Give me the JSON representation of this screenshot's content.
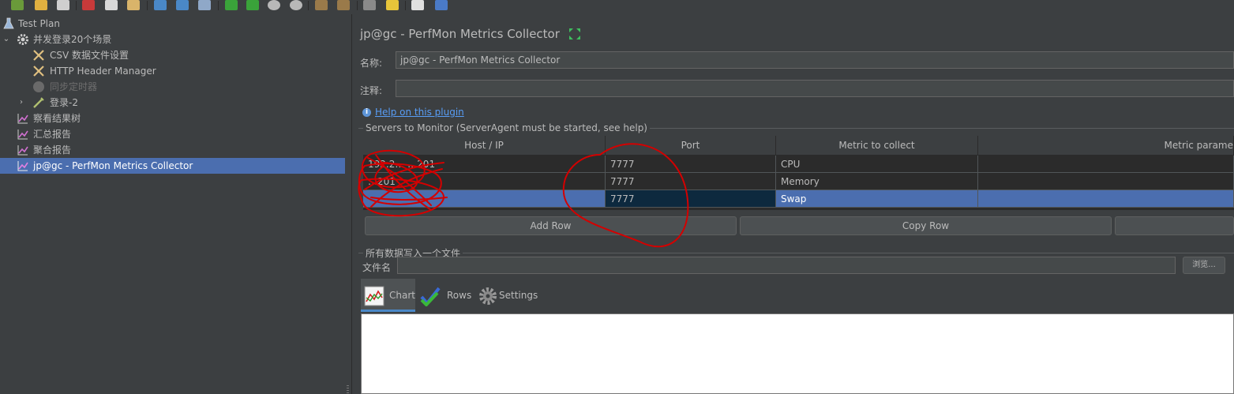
{
  "tree": {
    "items": [
      {
        "label": "Test Plan",
        "icon": "flask-icon"
      },
      {
        "label": "并发登录20个场景",
        "icon": "gear-icon"
      },
      {
        "label": "CSV 数据文件设置",
        "icon": "wrench-icon"
      },
      {
        "label": "HTTP Header Manager",
        "icon": "wrench-icon"
      },
      {
        "label": "同步定时器",
        "icon": "timer-icon",
        "disabled": true
      },
      {
        "label": "登录-2",
        "icon": "pipette-icon"
      },
      {
        "label": "察看结果树",
        "icon": "graph-icon"
      },
      {
        "label": "汇总报告",
        "icon": "graph-icon"
      },
      {
        "label": "聚合报告",
        "icon": "graph-icon"
      },
      {
        "label": "jp@gc - PerfMon Metrics Collector",
        "icon": "graph-icon",
        "selected": true
      }
    ]
  },
  "panel": {
    "title": "jp@gc - PerfMon Metrics Collector",
    "name_label": "名称:",
    "name_value": "jp@gc - PerfMon Metrics Collector",
    "comment_label": "注释:",
    "comment_value": "",
    "help_link": "Help on this plugin",
    "servers_group_title": "Servers to Monitor (ServerAgent must be started, see help)",
    "table": {
      "columns": [
        "Host / IP",
        "Port",
        "Metric to collect",
        "Metric parame"
      ],
      "rows": [
        {
          "host": "192.2…  …201",
          "port": "7777",
          "metric": "CPU",
          "param": ""
        },
        {
          "host": "…201",
          "port": "7777",
          "metric": "Memory",
          "param": ""
        },
        {
          "host": "",
          "port": "7777",
          "metric": "Swap",
          "param": ""
        }
      ]
    },
    "buttons": {
      "add_row": "Add Row",
      "copy_row": "Copy Row"
    },
    "file_group_title": "所有数据写入一个文件",
    "file_label": "文件名",
    "browse_label": "浏览...",
    "tabs": [
      {
        "label": "Chart",
        "icon": "chart-icon"
      },
      {
        "label": "Rows",
        "icon": "checkmark-icon"
      },
      {
        "label": "Settings",
        "icon": "gear-icon"
      }
    ]
  },
  "colors": {
    "background": "#3c3f41",
    "selection": "#4b6eaf",
    "link": "#589df6",
    "annotation": "#d40000"
  }
}
